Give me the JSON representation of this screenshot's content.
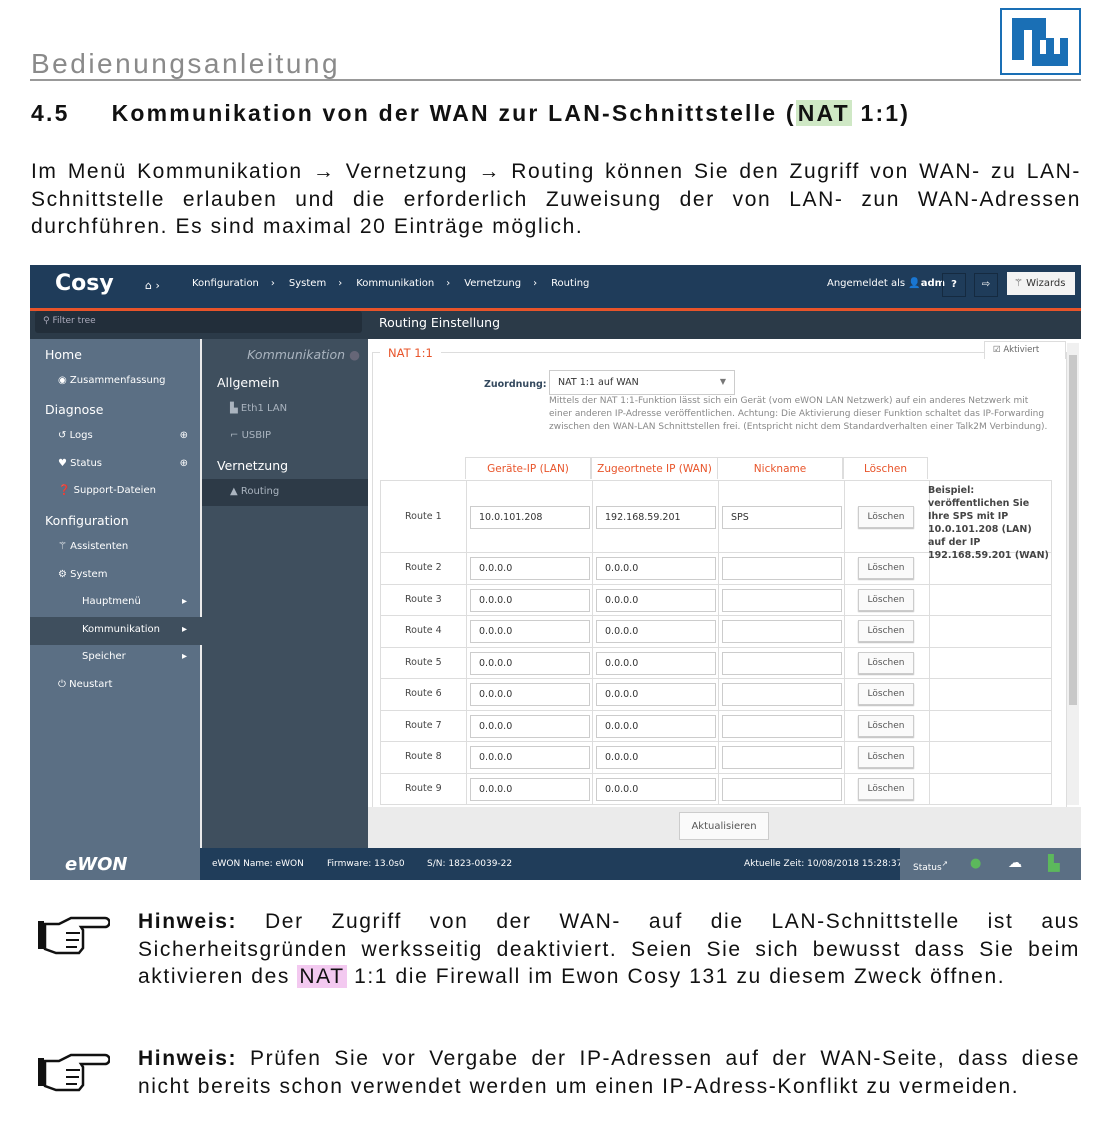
{
  "document": {
    "header": "Bedienungsanleitung",
    "logo_text": "RW",
    "section_number": "4.5",
    "section_title_pre": "Kommunikation von der WAN zur LAN-Schnittstelle (",
    "section_title_nat": "NAT",
    "section_title_post": " 1:1)",
    "intro": "Im Menü Kommunikation → Vernetzung → Routing können Sie den Zugriff von WAN- zu LAN-Schnittstelle erlauben und die erforderlich Zuweisung der von LAN- zun WAN-Adressen durchführen. Es sind maximal 20 Einträge möglich.",
    "hints": [
      {
        "label": "Hinweis:",
        "pre": " Der Zugriff von der WAN- auf die LAN-Schnittstelle ist aus Sicherheitsgründen werksseitig deaktiviert. Seien Sie sich bewusst dass Sie beim aktivieren des ",
        "nat": "NAT",
        "post": " 1:1 die Firewall im Ewon Cosy 131 zu diesem Zweck öffnen.",
        "icon": "pointing-hand-icon"
      },
      {
        "label": "Hinweis:",
        "text": " Prüfen Sie vor Vergabe der IP-Adressen auf der WAN-Seite, dass diese nicht bereits schon verwendet werden um einen IP-Adress-Konflikt zu vermeiden.",
        "icon": "pointing-hand-icon"
      }
    ]
  },
  "app": {
    "brand": "Cosy",
    "breadcrumb": [
      "Konfiguration",
      "System",
      "Kommunikation",
      "Vernetzung",
      "Routing"
    ],
    "logged_in_label": "Angemeldet als",
    "user": "adm",
    "wizards": "Wizards",
    "filter_placeholder": "Filter tree",
    "page_title": "Routing Einstellung",
    "sidebar": {
      "home": "Home",
      "zusammenfassung": "Zusammenfassung",
      "diagnose": "Diagnose",
      "logs": "Logs",
      "status": "Status",
      "support": "Support-Dateien",
      "konfiguration": "Konfiguration",
      "assistenten": "Assistenten",
      "system": "System",
      "hauptmenu": "Hauptmenü",
      "kommunikation": "Kommunikation",
      "speicher": "Speicher",
      "neustart": "Neustart"
    },
    "subnav": {
      "title": "Kommunikation",
      "allgemein": "Allgemein",
      "eth1": "Eth1 LAN",
      "usbip": "USBIP",
      "vernetzung": "Vernetzung",
      "routing": "Routing"
    },
    "panel": {
      "legend": "NAT 1:1",
      "aktiviert": "Aktiviert",
      "zuordnung_label": "Zuordnung:",
      "zuordnung_value": "NAT 1:1 auf WAN",
      "help": "Mittels der NAT 1:1-Funktion lässt sich ein Gerät (vom eWON LAN Netzwerk) auf ein anderes Netzwerk mit einer anderen IP-Adresse veröffentlichen. Achtung: Die Aktivierung dieser Funktion schaltet das IP-Forwarding zwischen den WAN-LAN Schnittstellen frei. (Entspricht nicht dem Standardverhalten einer Talk2M Verbindung).",
      "columns": [
        "Geräte-IP (LAN)",
        "Zugeortnete IP (WAN)",
        "Nickname",
        "Löschen"
      ],
      "example": "Beispiel: veröffentlichen Sie Ihre SPS mit IP 10.0.101.208 (LAN) auf der IP 192.168.59.201 (WAN)",
      "delete_label": "Löschen",
      "routes": [
        {
          "name": "Route 1",
          "lan": "10.0.101.208",
          "wan": "192.168.59.201",
          "nick": "SPS"
        },
        {
          "name": "Route 2",
          "lan": "0.0.0.0",
          "wan": "0.0.0.0",
          "nick": ""
        },
        {
          "name": "Route 3",
          "lan": "0.0.0.0",
          "wan": "0.0.0.0",
          "nick": ""
        },
        {
          "name": "Route 4",
          "lan": "0.0.0.0",
          "wan": "0.0.0.0",
          "nick": ""
        },
        {
          "name": "Route 5",
          "lan": "0.0.0.0",
          "wan": "0.0.0.0",
          "nick": ""
        },
        {
          "name": "Route 6",
          "lan": "0.0.0.0",
          "wan": "0.0.0.0",
          "nick": ""
        },
        {
          "name": "Route 7",
          "lan": "0.0.0.0",
          "wan": "0.0.0.0",
          "nick": ""
        },
        {
          "name": "Route 8",
          "lan": "0.0.0.0",
          "wan": "0.0.0.0",
          "nick": ""
        },
        {
          "name": "Route 9",
          "lan": "0.0.0.0",
          "wan": "0.0.0.0",
          "nick": ""
        }
      ],
      "update": "Aktualisieren"
    },
    "footer": {
      "logo": "eWON",
      "name": "eWON Name: eWON",
      "firmware": "Firmware: 13.0s0",
      "sn": "S/N: 1823-0039-22",
      "time": "Aktuelle Zeit: 10/08/2018 15:28:37",
      "status": "Status"
    },
    "colors": {
      "navy": "#1f3c5a",
      "accent": "#e8542a",
      "sidebar": "#5b6f84"
    }
  }
}
